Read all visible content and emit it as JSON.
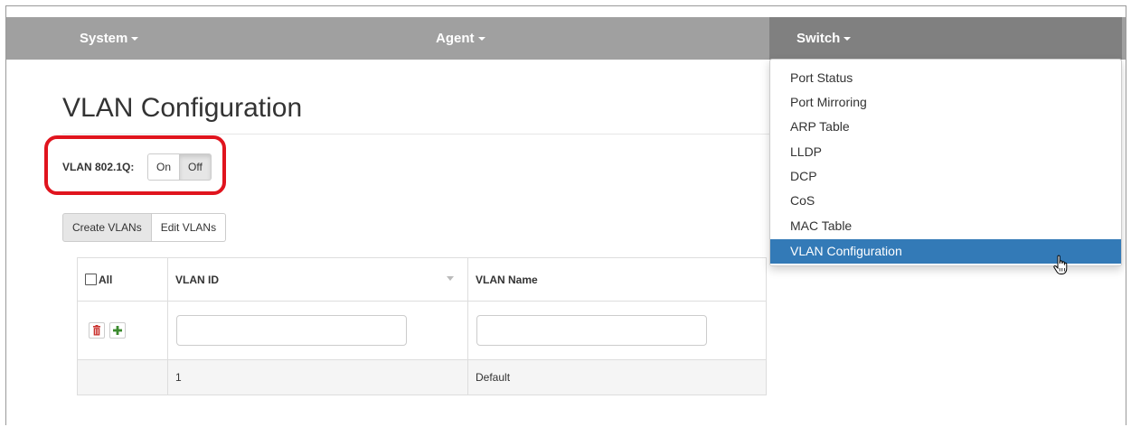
{
  "nav": {
    "system": "System",
    "agent": "Agent",
    "switch": "Switch"
  },
  "page": {
    "title": "VLAN Configuration"
  },
  "vlan_toggle": {
    "label": "VLAN 802.1Q:",
    "on": "On",
    "off": "Off",
    "selected": "Off"
  },
  "tabs": {
    "create": "Create VLANs",
    "edit": "Edit VLANs",
    "active": "Create VLANs"
  },
  "table": {
    "headers": {
      "all": "All",
      "vlan_id": "VLAN ID",
      "vlan_name": "VLAN Name"
    },
    "new_row": {
      "vlan_id": "",
      "vlan_name": ""
    },
    "rows": [
      {
        "vlan_id": "1",
        "vlan_name": "Default"
      }
    ]
  },
  "switch_menu": {
    "items": [
      "Port Status",
      "Port Mirroring",
      "ARP Table",
      "LLDP",
      "DCP",
      "CoS",
      "MAC Table",
      "VLAN Configuration"
    ],
    "active": "VLAN Configuration"
  },
  "colors": {
    "navbar": "#a0a0a0",
    "navbar_active": "#808080",
    "menu_active": "#337ab7",
    "highlight_box": "#e0141e"
  }
}
